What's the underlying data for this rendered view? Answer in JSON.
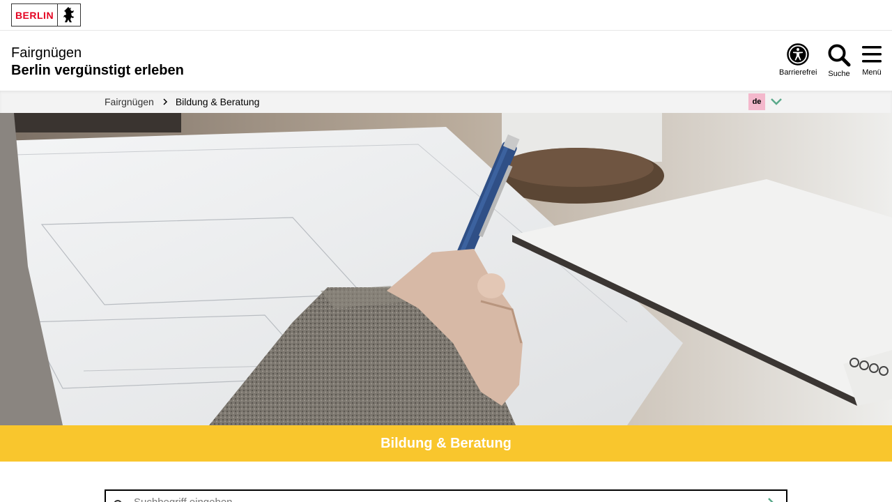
{
  "logo": {
    "text": "BERLIN"
  },
  "site": {
    "title_line1": "Fairgnügen",
    "title_line2": "Berlin vergünstigt erleben"
  },
  "header_buttons": {
    "accessibility": "Barrierefrei",
    "search": "Suche",
    "menu": "Menü"
  },
  "breadcrumb": {
    "items": [
      "Fairgnügen",
      "Bildung & Beratung"
    ]
  },
  "language": {
    "selected": "de"
  },
  "page": {
    "title": "Bildung & Beratung"
  },
  "search": {
    "placeholder": "Suchbegriff eingeben"
  },
  "colors": {
    "brand_red": "#e40422",
    "accent_yellow": "#f9c62d",
    "language_badge": "#f4b8cc",
    "chevron_green": "#5aa98a"
  }
}
